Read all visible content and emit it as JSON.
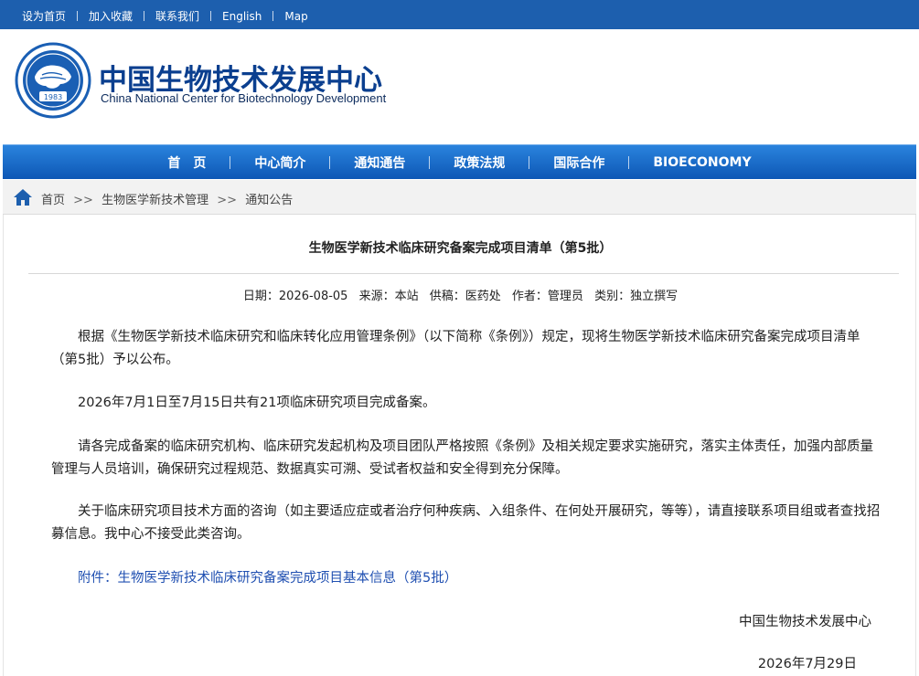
{
  "topbar": {
    "links": [
      "设为首页",
      "加入收藏",
      "联系我们",
      "English",
      "Map"
    ]
  },
  "header": {
    "title_cn": "中国生物技术发展中心",
    "title_en": "China National Center for Biotechnology Development",
    "logo_year": "1983"
  },
  "nav": {
    "items": [
      "首　页",
      "中心简介",
      "通知通告",
      "政策法规",
      "国际合作",
      "BIOECONOMY"
    ]
  },
  "breadcrumb": {
    "icon": "home-icon",
    "home": "首页",
    "sep": ">>",
    "level1": "生物医学新技术管理",
    "level2": "通知公告"
  },
  "article": {
    "title": "生物医学新技术临床研究备案完成项目清单（第5批）",
    "meta": {
      "date": "日期：2026-08-05",
      "source": "来源：本站",
      "provider": "供稿：医药处",
      "author": "作者：管理员",
      "category": "类别：独立撰写"
    },
    "paragraphs": [
      "根据《生物医学新技术临床研究和临床转化应用管理条例》（以下简称《条例》）规定，现将生物医学新技术临床研究备案完成项目清单（第5批）予以公布。",
      "2026年7月1日至7月15日共有21项临床研究项目完成备案。",
      "请各完成备案的临床研究机构、临床研究发起机构及项目团队严格按照《条例》及相关规定要求实施研究，落实主体责任，加强内部质量管理与人员培训，确保研究过程规范、数据真实可溯、受试者权益和安全得到充分保障。",
      "关于临床研究项目技术方面的咨询（如主要适应症或者治疗何种疾病、入组条件、在何处开展研究，等等），请直接联系项目组或者查找招募信息。我中心不接受此类咨询。"
    ],
    "attachment": "附件：生物医学新技术临床研究备案完成项目基本信息（第5批）",
    "signature_org": "中国生物技术发展中心",
    "signature_date": "2026年7月29日"
  },
  "colors": {
    "topbar": "#1d5fae",
    "nav_top": "#2a83dd",
    "nav_bottom": "#0d57b5",
    "brand_text": "#0b3f8f",
    "link": "#1f4fb1"
  }
}
